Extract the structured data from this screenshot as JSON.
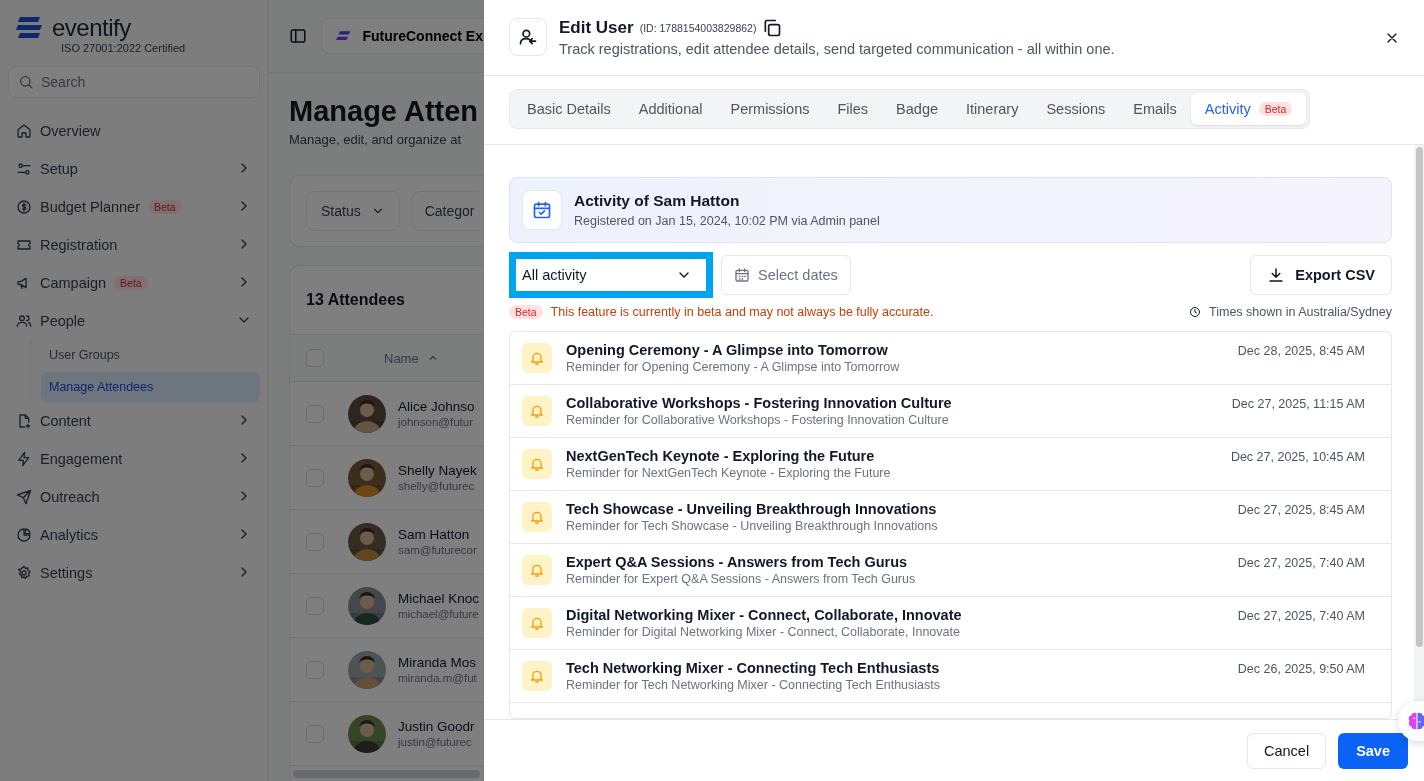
{
  "brand": {
    "name": "eventify",
    "certification": "ISO 27001:2022 Certified"
  },
  "sidebar": {
    "search": {
      "placeholder": "Search"
    },
    "items": [
      {
        "label": "Overview",
        "kind": "link"
      },
      {
        "label": "Setup",
        "kind": "group",
        "expanded": false
      },
      {
        "label": "Budget Planner",
        "kind": "group",
        "expanded": false,
        "badge": "Beta"
      },
      {
        "label": "Registration",
        "kind": "group",
        "expanded": false
      },
      {
        "label": "Campaign",
        "kind": "group",
        "expanded": false,
        "badge": "Beta"
      },
      {
        "label": "People",
        "kind": "group",
        "expanded": true,
        "children": [
          {
            "label": "User Groups",
            "selected": false
          },
          {
            "label": "Manage Attendees",
            "selected": true
          }
        ]
      },
      {
        "label": "Content",
        "kind": "group",
        "expanded": false
      },
      {
        "label": "Engagement",
        "kind": "group",
        "expanded": false
      },
      {
        "label": "Outreach",
        "kind": "group",
        "expanded": false
      },
      {
        "label": "Analytics",
        "kind": "group",
        "expanded": false
      },
      {
        "label": "Settings",
        "kind": "group",
        "expanded": false
      }
    ]
  },
  "topbar": {
    "event": "FutureConnect Ex"
  },
  "page": {
    "title": "Manage Atten",
    "subtitle": "Manage, edit, and organize at",
    "filters": [
      "Status",
      "Categor"
    ],
    "table": {
      "count": "13 Attendees",
      "name_column": "Name",
      "select_all_checked": false,
      "rows": [
        {
          "name": "Alice Johnso",
          "email": "johnson@futur",
          "checked": false
        },
        {
          "name": "Shelly Nayek",
          "email": "shelly@futurec",
          "checked": false
        },
        {
          "name": "Sam Hatton",
          "email": "sam@futurecor",
          "checked": false
        },
        {
          "name": "Michael Knoc",
          "email": "michael@future",
          "checked": false
        },
        {
          "name": "Miranda Mos",
          "email": "miranda.m@fut",
          "checked": false
        },
        {
          "name": "Justin Goodr",
          "email": "justin@futurec",
          "checked": false
        }
      ]
    }
  },
  "drawer": {
    "title": "Edit User",
    "id": "(ID: 1788154003829862)",
    "subtitle": "Track registrations, edit attendee details, send targeted communication - all within one.",
    "tabs": [
      {
        "label": "Basic Details",
        "selected": false
      },
      {
        "label": "Additional",
        "selected": false
      },
      {
        "label": "Permissions",
        "selected": false
      },
      {
        "label": "Files",
        "selected": false
      },
      {
        "label": "Badge",
        "selected": false
      },
      {
        "label": "Itinerary",
        "selected": false
      },
      {
        "label": "Sessions",
        "selected": false
      },
      {
        "label": "Emails",
        "selected": false
      },
      {
        "label": "Activity",
        "selected": true,
        "badge": "Beta"
      }
    ],
    "activity": {
      "title": "Activity of Sam Hatton",
      "registered": "Registered on Jan 15, 2024, 10:02 PM via Admin panel",
      "filter": "All activity",
      "dates_placeholder": "Select dates",
      "export": "Export CSV",
      "beta_badge": "Beta",
      "beta_note": "This feature is currently in beta and may not always be fully accurate.",
      "timezone": "Times shown in Australia/Sydney",
      "items": [
        {
          "title": "Opening Ceremony - A Glimpse into Tomorrow",
          "detail": "Reminder for Opening Ceremony - A Glimpse into Tomorrow",
          "time": "Dec 28, 2025, 8:45 AM"
        },
        {
          "title": "Collaborative Workshops - Fostering Innovation Culture",
          "detail": "Reminder for Collaborative Workshops - Fostering Innovation Culture",
          "time": "Dec 27, 2025, 11:15 AM"
        },
        {
          "title": "NextGenTech Keynote - Exploring the Future",
          "detail": "Reminder for NextGenTech Keynote - Exploring the Future",
          "time": "Dec 27, 2025, 10:45 AM"
        },
        {
          "title": "Tech Showcase - Unveiling Breakthrough Innovations",
          "detail": "Reminder for Tech Showcase - Unveiling Breakthrough Innovations",
          "time": "Dec 27, 2025, 8:45 AM"
        },
        {
          "title": "Expert Q&A Sessions - Answers from Tech Gurus",
          "detail": "Reminder for Expert Q&A Sessions - Answers from Tech Gurus",
          "time": "Dec 27, 2025, 7:40 AM"
        },
        {
          "title": "Digital Networking Mixer - Connect, Collaborate, Innovate",
          "detail": "Reminder for Digital Networking Mixer - Connect, Collaborate, Innovate",
          "time": "Dec 27, 2025, 7:40 AM"
        },
        {
          "title": "Tech Networking Mixer - Connecting Tech Enthusiasts",
          "detail": "Reminder for Tech Networking Mixer - Connecting Tech Enthusiasts",
          "time": "Dec 26, 2025, 9:50 AM"
        }
      ]
    },
    "buttons": {
      "cancel": "Cancel",
      "save": "Save"
    }
  }
}
